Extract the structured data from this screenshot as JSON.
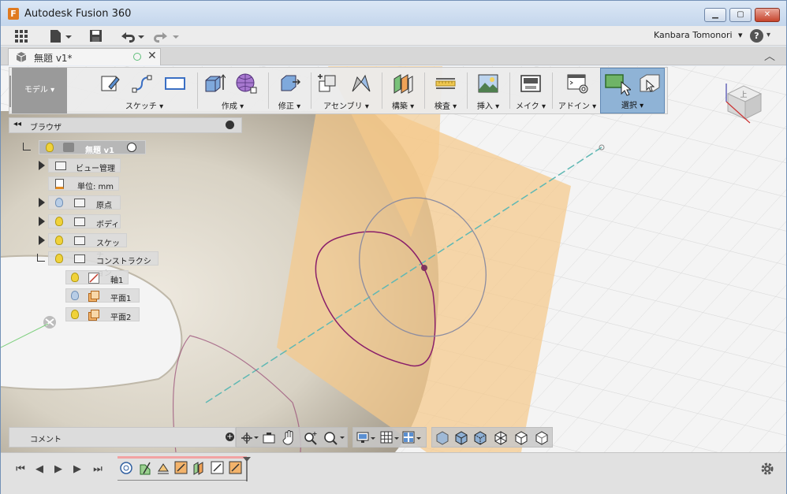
{
  "window": {
    "app_logo": "F",
    "title": "Autodesk Fusion 360",
    "minimize_label": "▁",
    "maximize_label": "▢",
    "close_label": "✕"
  },
  "menubar": {
    "user_name": "Kanbara Tomonori",
    "help_label": "?"
  },
  "doc_tab": {
    "title": "無題 v1*"
  },
  "toolbar": {
    "workspace_label": "モデル",
    "groups": [
      {
        "label": "スケッチ"
      },
      {
        "label": "作成"
      },
      {
        "label": "修正"
      },
      {
        "label": "アセンブリ"
      },
      {
        "label": "構築"
      },
      {
        "label": "検査"
      },
      {
        "label": "挿入"
      },
      {
        "label": "メイク"
      },
      {
        "label": "アドイン"
      },
      {
        "label": "選択"
      }
    ]
  },
  "browser": {
    "title": "ブラウザ",
    "root_label": "無題 v1",
    "items": [
      {
        "label": "ビュー管理"
      },
      {
        "label": "単位: mm"
      },
      {
        "label": "原点"
      },
      {
        "label": "ボディ"
      },
      {
        "label": "スケッチ"
      },
      {
        "label": "コンストラクション"
      },
      {
        "label": "軸1"
      },
      {
        "label": "平面1"
      },
      {
        "label": "平面2"
      }
    ]
  },
  "comment": {
    "label": "コメント"
  },
  "view_cube": {
    "face_label": "上"
  },
  "colors": {
    "accent_orange": "#f5c98a",
    "select_active": "#8fb3d6",
    "sketch_curve": "#8a1f6a"
  }
}
